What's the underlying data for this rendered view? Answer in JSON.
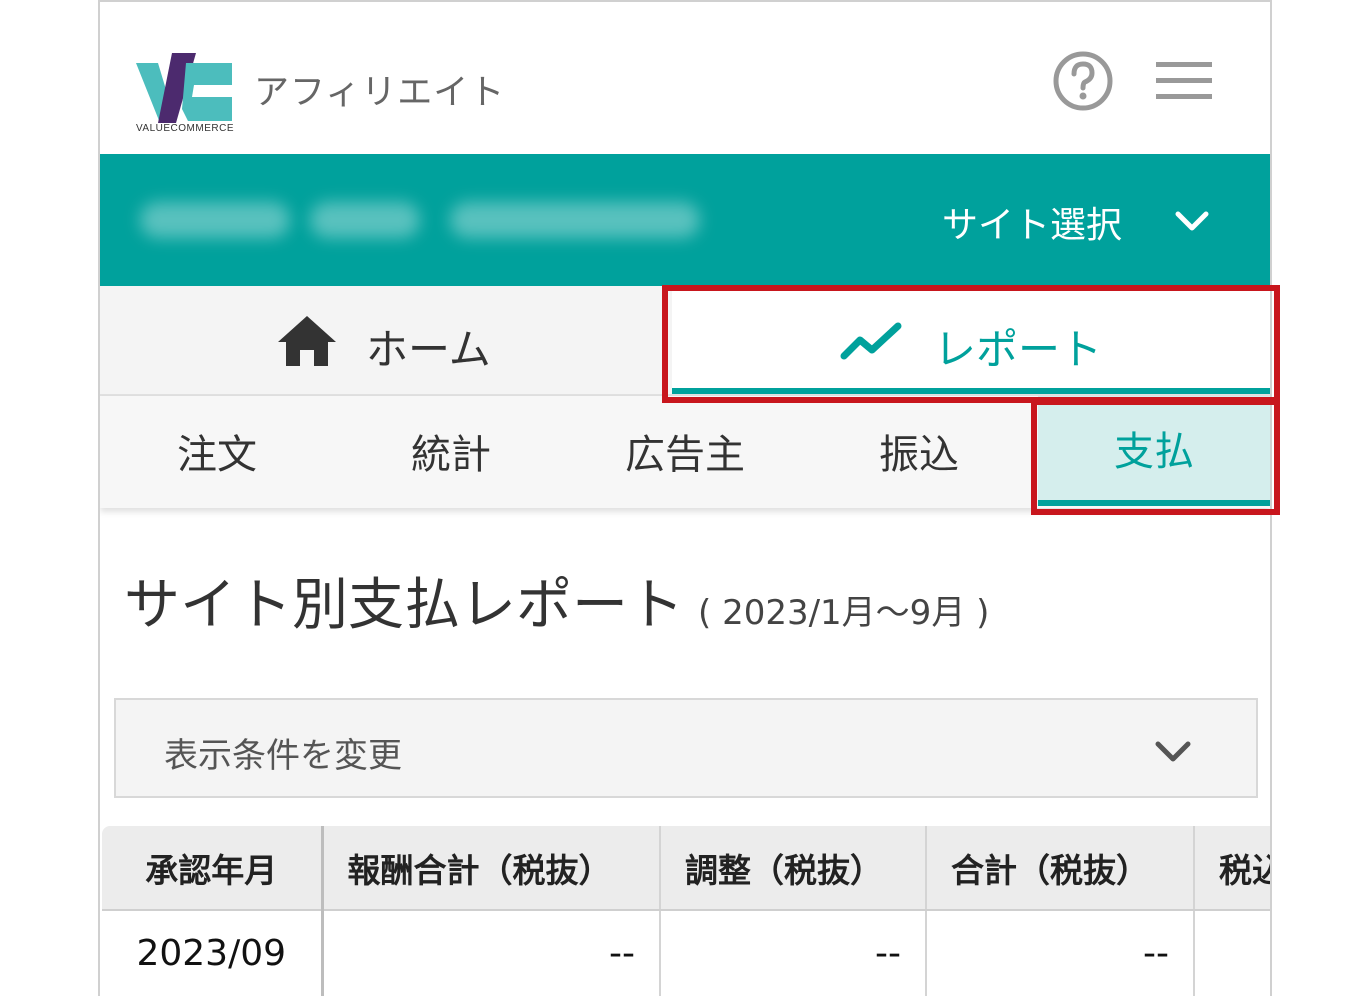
{
  "header": {
    "logo_text": "VALUECOMMERCE",
    "app_name": "アフィリエイト",
    "help_icon": "question-circle-icon",
    "menu_icon": "hamburger-menu-icon"
  },
  "site_bar": {
    "select_label": "サイト選択",
    "chevron_icon": "chevron-down-icon"
  },
  "nav": {
    "tabs": [
      {
        "label": "ホーム",
        "icon": "home-icon",
        "active": false
      },
      {
        "label": "レポート",
        "icon": "trend-line-icon",
        "active": true
      }
    ]
  },
  "subnav": {
    "tabs": [
      {
        "label": "注文",
        "active": false
      },
      {
        "label": "統計",
        "active": false
      },
      {
        "label": "広告主",
        "active": false
      },
      {
        "label": "振込",
        "active": false
      },
      {
        "label": "支払",
        "active": true
      }
    ]
  },
  "page": {
    "title": "サイト別支払レポート",
    "range": "( 2023/1月～9月 )"
  },
  "filter": {
    "label": "表示条件を変更",
    "chevron_icon": "chevron-down-icon"
  },
  "table": {
    "headers": [
      "承認年月",
      "報酬合計（税抜）",
      "調整（税抜）",
      "合計（税抜）",
      "税込"
    ],
    "rows": [
      [
        "2023/09",
        "--",
        "--",
        "--",
        ""
      ]
    ]
  },
  "colors": {
    "brand_teal": "#00a19c",
    "active_subtab_bg": "#d5eeed",
    "highlight_red": "#c8161d"
  }
}
